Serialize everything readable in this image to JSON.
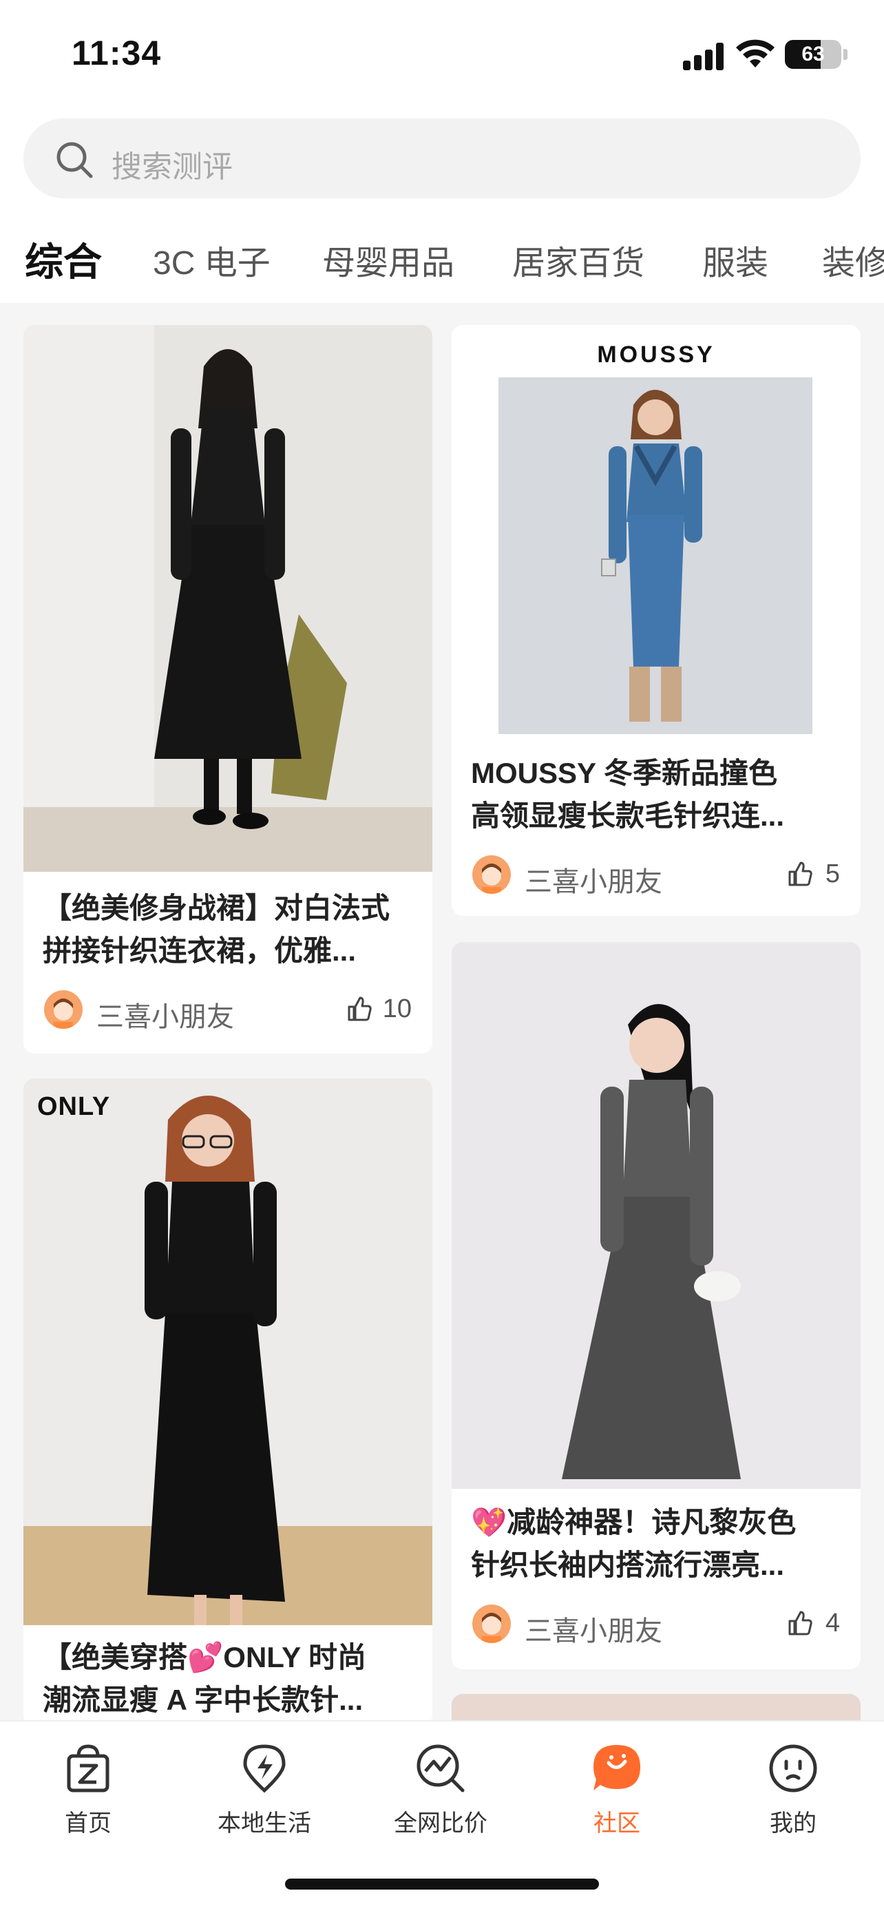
{
  "status": {
    "time": "11:34",
    "battery": "63",
    "battery_level": 0.63
  },
  "search": {
    "placeholder": "搜索测评",
    "icon": "search-icon"
  },
  "tabs": [
    {
      "label": "综合",
      "active": true
    },
    {
      "label": "3C 电子",
      "active": false
    },
    {
      "label": "母婴用品",
      "active": false
    },
    {
      "label": "居家百货",
      "active": false
    },
    {
      "label": "服装",
      "active": false
    },
    {
      "label": "装修",
      "active": false
    }
  ],
  "feed": {
    "left": [
      {
        "title_line1": "【绝美修身战裙】对白法式",
        "title_line2": "拼接针织连衣裙，优雅...",
        "author": "三喜小朋友",
        "likes": "10"
      },
      {
        "brand": "ONLY",
        "title_line1": "【绝美穿搭💕ONLY 时尚",
        "title_line2": "潮流显瘦 A 字中长款针..."
      }
    ],
    "right": [
      {
        "brand": "MOUSSY",
        "title_line1": "MOUSSY 冬季新品撞色",
        "title_line2": "高领显瘦长款毛针织连...",
        "author": "三喜小朋友",
        "likes": "5"
      },
      {
        "title_line1": "💖减龄神器！诗凡黎灰色",
        "title_line2": "针织长袖内搭流行漂亮...",
        "author": "三喜小朋友",
        "likes": "4"
      }
    ]
  },
  "tabbar": [
    {
      "label": "首页",
      "icon": "bag-icon"
    },
    {
      "label": "本地生活",
      "icon": "lightning-icon"
    },
    {
      "label": "全网比价",
      "icon": "chart-search-icon"
    },
    {
      "label": "社区",
      "icon": "chat-bubble-icon",
      "active": true
    },
    {
      "label": "我的",
      "icon": "smiley-face-icon"
    }
  ],
  "colors": {
    "accent": "#ff6b2c",
    "background": "#f5f5f5"
  }
}
